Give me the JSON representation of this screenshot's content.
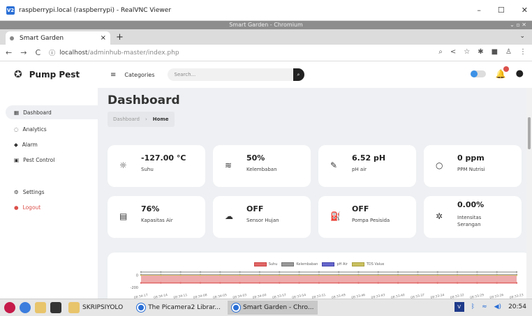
{
  "vnc": {
    "title": "raspberrypi.local (raspberrypi) - RealVNC Viewer",
    "logo": "V2"
  },
  "chrome": {
    "window_title": "Smart Garden - Chromium"
  },
  "tab": {
    "label": "Smart Garden"
  },
  "address": {
    "host": "localhost",
    "path": "/adminhub-master/index.php"
  },
  "app": {
    "brand": "Pump Pest",
    "categories": "Categories",
    "search_placeholder": "Search..."
  },
  "sidebar": {
    "items": [
      {
        "label": "Dashboard",
        "icon": "dashboard-icon",
        "active": true
      },
      {
        "label": "Analytics",
        "icon": "analytics-icon"
      },
      {
        "label": "Alarm",
        "icon": "alarm-icon"
      },
      {
        "label": "Pest Control",
        "icon": "pest-control-icon"
      },
      {
        "label": "Settings",
        "icon": "settings-icon"
      },
      {
        "label": "Logout",
        "icon": "logout-icon"
      }
    ]
  },
  "main": {
    "title": "Dashboard",
    "breadcrumb": {
      "root": "Dashboard",
      "current": "Home"
    },
    "cards": [
      {
        "value": "-127.00 °C",
        "label": "Suhu",
        "icon": "sun-icon"
      },
      {
        "value": "50%",
        "label": "Kelembaban",
        "icon": "waves-icon"
      },
      {
        "value": "6.52 pH",
        "label": "pH air",
        "icon": "eyedropper-icon"
      },
      {
        "value": "0 ppm",
        "label": "PPM Nutrisi",
        "icon": "droplet-icon"
      },
      {
        "value": "76%",
        "label": "Kapasitas Air",
        "icon": "archive-icon"
      },
      {
        "value": "OFF",
        "label": "Sensor Hujan",
        "icon": "cloud-rain-icon"
      },
      {
        "value": "OFF",
        "label": "Pompa Pesisida",
        "icon": "fuel-pump-icon"
      },
      {
        "value": "0.00%",
        "label": "Intensitas Serangan",
        "icon": "bug-icon"
      }
    ]
  },
  "chart_data": {
    "type": "line",
    "series": [
      {
        "name": "Suhu",
        "color": "#e06666",
        "value": -127
      },
      {
        "name": "Kelembaban",
        "color": "#999999",
        "value": 50
      },
      {
        "name": "pH Air",
        "color": "#6666cc",
        "value": 6.52
      },
      {
        "name": "TDS Value",
        "color": "#c9c060",
        "value": 0
      }
    ],
    "y_ticks": [
      "0",
      "-200"
    ],
    "x_labels": [
      "08:34:17",
      "08:34:14",
      "08:34:11",
      "08:34:08",
      "08:34:05",
      "08:34:03",
      "08:34:00",
      "08:33:57",
      "08:33:54",
      "08:33:51",
      "08:33:49",
      "08:33:46",
      "08:33:43",
      "08:33:40",
      "08:33:37",
      "08:33:34",
      "08:33:32",
      "08:33:29",
      "08:33:26",
      "08:33:23"
    ]
  },
  "taskbar": {
    "folder": "SKRIPSIYOLO",
    "windows": [
      "The Picamera2 Librar...",
      "Smart Garden - Chro..."
    ],
    "time": "20:54"
  }
}
